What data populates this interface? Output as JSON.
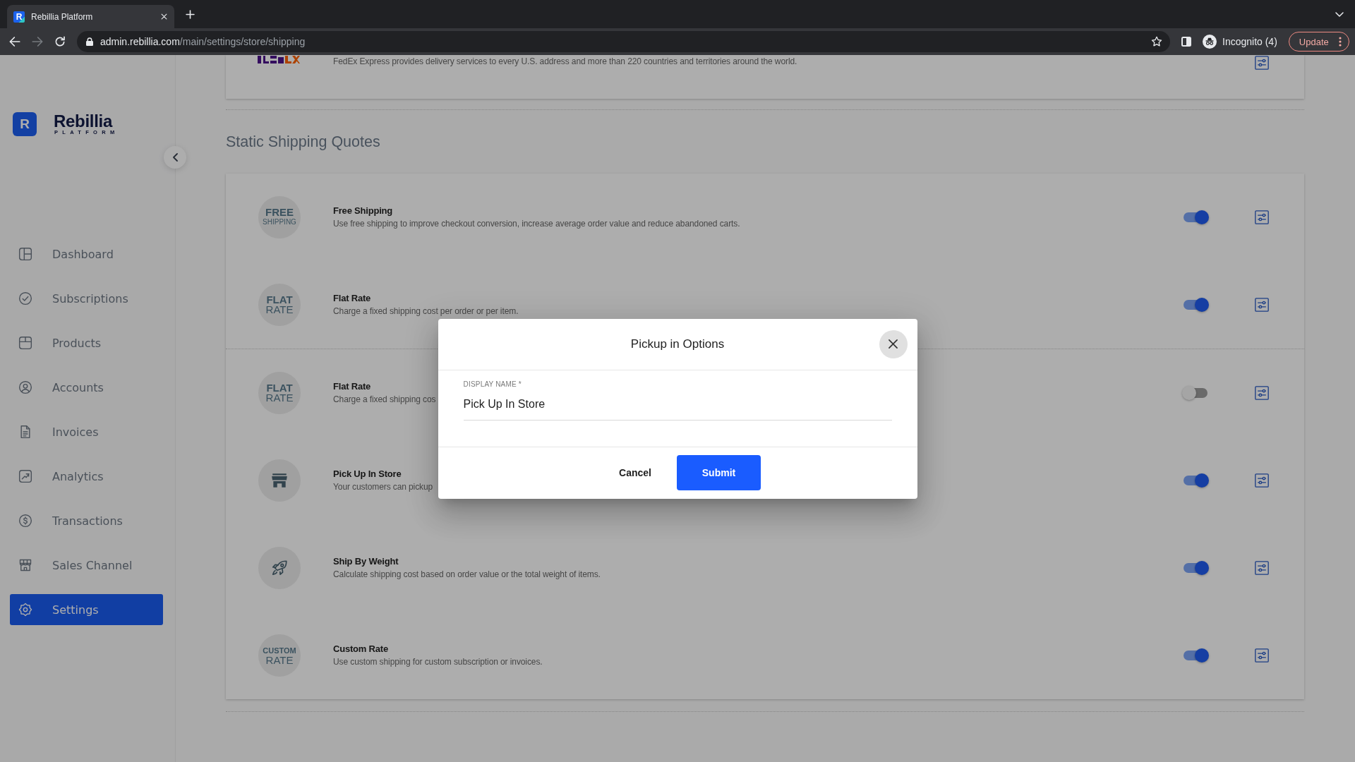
{
  "browser": {
    "tab": {
      "favicon": "R",
      "title": "Rebillia Platform",
      "selected": true
    },
    "nav_buttons": [
      {
        "kind": "back",
        "disabled": false
      },
      {
        "kind": "forward",
        "disabled": true
      },
      {
        "kind": "reload",
        "disabled": false
      }
    ],
    "address": {
      "host": "admin.rebillia.com",
      "path": "/main/settings/store/shipping"
    },
    "profile": "Incognito (4)",
    "update": "Update"
  },
  "sidebar": {
    "brand": {
      "mark": "R",
      "name": "Rebillia",
      "tagline": "PLATFORM"
    },
    "items": [
      {
        "kind": "dashboard",
        "label": "Dashboard",
        "selected": false
      },
      {
        "kind": "subscriptions",
        "label": "Subscriptions",
        "selected": false
      },
      {
        "kind": "products",
        "label": "Products",
        "selected": false
      },
      {
        "kind": "accounts",
        "label": "Accounts",
        "selected": false
      },
      {
        "kind": "invoices",
        "label": "Invoices",
        "selected": false
      },
      {
        "kind": "analytics",
        "label": "Analytics",
        "selected": false
      },
      {
        "kind": "transactions",
        "label": "Transactions",
        "selected": false
      },
      {
        "kind": "sales_channel",
        "label": "Sales Channel",
        "selected": false
      },
      {
        "kind": "settings",
        "label": "Settings",
        "selected": true
      }
    ]
  },
  "carrier_card": {
    "description": "FedEx Express provides delivery services to every U.S. address and more than 220 countries and territories around the world."
  },
  "static_shipping_quotes": {
    "title": "Static Shipping Quotes",
    "groups": [
      {
        "rows": [
          {
            "badge": {
              "kind": "text",
              "lines": [
                "FREE",
                "SHIPPING"
              ]
            },
            "title": "Free Shipping",
            "description": "Use free shipping to improve checkout conversion, increase average order value and reduce abandoned carts.",
            "enabled": true
          },
          {
            "badge": {
              "kind": "text",
              "lines": [
                "FLAT",
                "RATE"
              ]
            },
            "title": "Flat Rate",
            "description": "Charge a fixed shipping cost per order or per item.",
            "enabled": true
          }
        ]
      },
      {
        "rows": [
          {
            "badge": {
              "kind": "text",
              "lines": [
                "FLAT",
                "RATE"
              ]
            },
            "title": "Flat Rate",
            "description": "Charge a fixed shipping cos",
            "enabled": false
          },
          {
            "badge": {
              "kind": "store"
            },
            "title": "Pick Up In Store",
            "description": "Your customers can pickup",
            "enabled": true
          },
          {
            "badge": {
              "kind": "rocket"
            },
            "title": "Ship By Weight",
            "description": "Calculate shipping cost based on order value or the total weight of items.",
            "enabled": true
          },
          {
            "badge": {
              "kind": "text",
              "lines": [
                "CUSTOM",
                "RATE"
              ]
            },
            "title": "Custom Rate",
            "description": "Use custom shipping for custom subscription or invoices.",
            "enabled": true
          }
        ]
      }
    ]
  },
  "modal": {
    "title": "Pickup in Options",
    "field": {
      "label": "DISPLAY NAME *",
      "value": "Pick Up In Store"
    },
    "buttons": [
      {
        "kind": "secondary",
        "label": "Cancel"
      },
      {
        "kind": "primary",
        "label": "Submit"
      }
    ]
  }
}
